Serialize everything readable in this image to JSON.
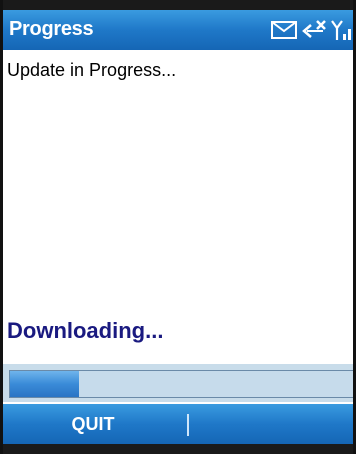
{
  "window": {
    "title": "Progress"
  },
  "status_icons": [
    "mail-icon",
    "no-connection-icon",
    "signal-strength-icon"
  ],
  "main": {
    "message": "Update in Progress...",
    "status_text": "Downloading..."
  },
  "progress": {
    "fraction": 0.2
  },
  "softkeys": {
    "left_label": "QUIT",
    "right_label": ""
  },
  "colors": {
    "title_bar": "#1f78c8",
    "status_text": "#1a1a80",
    "progress_fill": "#3a8bd8",
    "progress_track": "#c6dbeb"
  }
}
